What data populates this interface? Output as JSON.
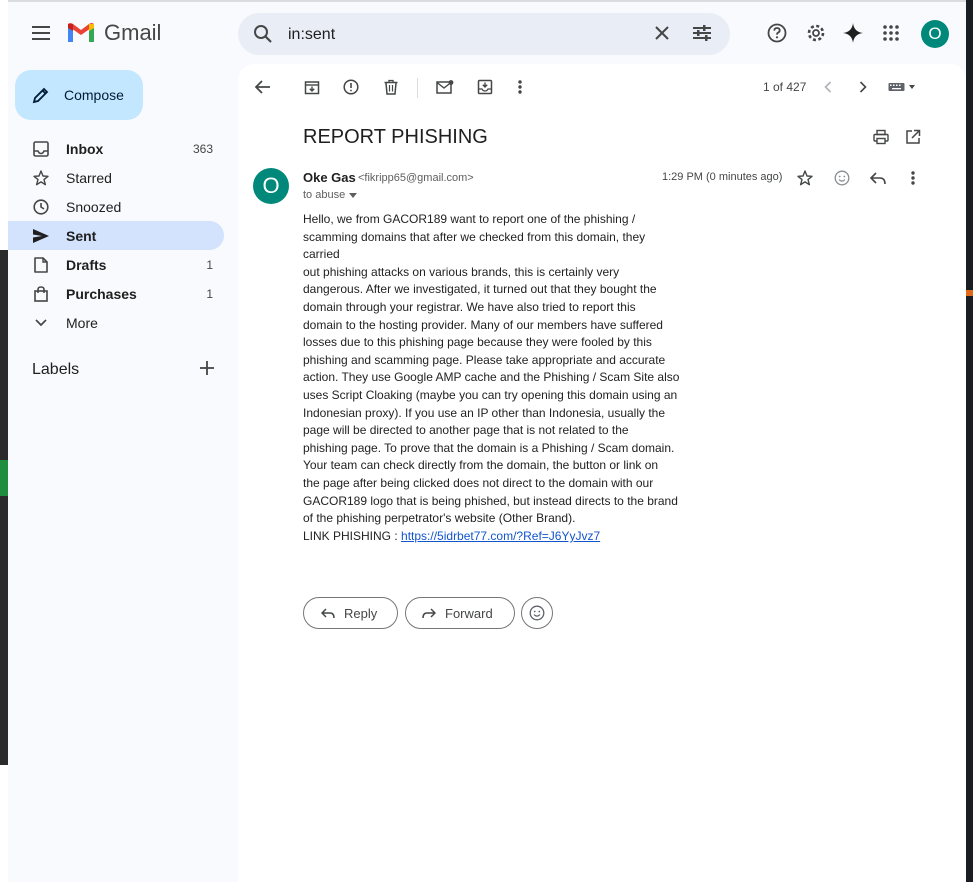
{
  "header": {
    "app_name": "Gmail",
    "search_value": "in:sent",
    "avatar_letter": "O"
  },
  "sidebar": {
    "compose_label": "Compose",
    "items": [
      {
        "label": "Inbox",
        "count": "363",
        "icon": "inbox-icon"
      },
      {
        "label": "Starred",
        "count": "",
        "icon": "star-icon"
      },
      {
        "label": "Snoozed",
        "count": "",
        "icon": "clock-icon"
      },
      {
        "label": "Sent",
        "count": "",
        "icon": "send-icon"
      },
      {
        "label": "Drafts",
        "count": "1",
        "icon": "draft-icon"
      },
      {
        "label": "Purchases",
        "count": "1",
        "icon": "shopping-bag-icon"
      },
      {
        "label": "More",
        "count": "",
        "icon": "chevron-down-icon"
      }
    ],
    "labels_title": "Labels"
  },
  "toolbar": {
    "pager": "1 of 427"
  },
  "email": {
    "subject": "REPORT PHISHING",
    "sender_initial": "O",
    "sender_name": "Oke Gas",
    "sender_email": "<fikripp65@gmail.com>",
    "to_line": "to abuse",
    "timestamp": "1:29 PM (0 minutes ago)",
    "body": "        Hello, we from GACOR189 want to report one of the phishing /\nscamming domains that after we checked from this domain, they carried\nout phishing attacks on various brands, this is certainly very\ndangerous. After we investigated, it turned out that they bought the\ndomain through your registrar. We have also tried to report this\ndomain to the hosting provider. Many of our members have suffered\nlosses due to this phishing page because they were fooled by this\nphishing and scamming page. Please take appropriate and accurate\naction. They use Google AMP cache and the Phishing / Scam Site also\nuses Script Cloaking (maybe you can try opening this domain using an\nIndonesian proxy). If you use an IP other than Indonesia, usually the\npage will be directed to another page that is not related to the\nphishing page. To prove that the domain is a Phishing / Scam domain.\nYour team can check directly from the domain, the button or link on\nthe page after being clicked does not direct to the domain with our\nGACOR189 logo that is being phished, but instead directs to the brand\nof the phishing perpetrator's website (Other Brand).",
    "link_label": "LINK PHISHING : ",
    "link_url": "https://5idrbet77.com/?Ref=J6YyJvz7"
  },
  "actions": {
    "reply_label": "Reply",
    "forward_label": "Forward"
  },
  "colors": {
    "compose_bg": "#c2e7ff",
    "active_nav_bg": "#d3e3fd",
    "avatar_teal": "#00897b",
    "link": "#1155cc"
  }
}
